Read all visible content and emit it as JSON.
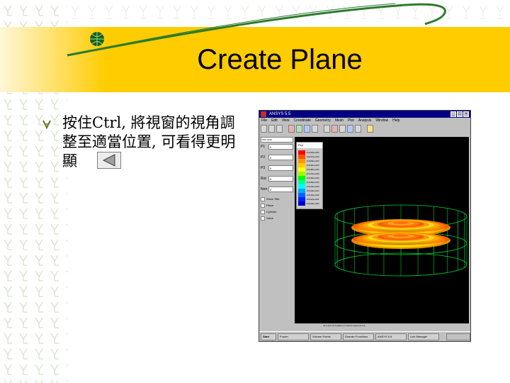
{
  "slide": {
    "title": "Create Plane",
    "bullet_text": "按住Ctrl, 將視窗的視角調整至適當位置, 可看得更明顯"
  },
  "icons": {
    "bullet": "bullet-glyph-icon",
    "back": "back-triangle-icon",
    "globe": "globe-logo-icon"
  },
  "colors": {
    "title_band": "#ffcc00",
    "swoosh": "#2d7a2d",
    "window_title": "#000080",
    "viewport": "#000000",
    "wireframe": "#00cc33"
  },
  "screenshot": {
    "window_title": "ANSYS 5.5",
    "menu": [
      "File",
      "Edit",
      "View",
      "Coordinate",
      "Geometry",
      "Mesh",
      "Plot",
      "Analysis",
      "Window",
      "Help"
    ],
    "panel_header": "xxx ooo",
    "params": [
      {
        "label": "P1",
        "value": "0"
      },
      {
        "label": "P2",
        "value": "0"
      },
      {
        "label": "P3",
        "value": "0"
      },
      {
        "label": "Rot",
        "value": "0"
      },
      {
        "label": "Nrm",
        "value": "0"
      }
    ],
    "checks": [
      "Show Title",
      "Plane",
      "Cylinder",
      "Value"
    ],
    "legend_title": "Plot",
    "legend_labels": [
      "-0.0220e+004",
      "-0.0210e+004",
      "-0.0200e+004",
      "-0.0190e+004",
      "-0.0180e+004",
      "-0.0170e+004",
      "-0.0160e+004",
      "-0.0150e+004",
      "-0.0140e+004",
      "-0.0130e+004",
      "-0.0120e+004",
      "-0.0110e+004",
      "-0.0100e+004"
    ],
    "legend_colors": [
      "#ff0000",
      "#ff5000",
      "#ff9900",
      "#ffcc00",
      "#ffff00",
      "#99ff00",
      "#00ff00",
      "#00ff99",
      "#00ffff",
      "#00aaff",
      "#0066ff",
      "#0022ff",
      "#0000cc"
    ],
    "coord_text": "x0.0  y0.0  z0.0  alpha 0.0  beta 0.0  gamma 0.0",
    "taskbar": [
      "Start",
      "Forum",
      "Volume Points",
      "Domain Functions",
      "ANSYS 5.5",
      "Link Manager"
    ]
  }
}
